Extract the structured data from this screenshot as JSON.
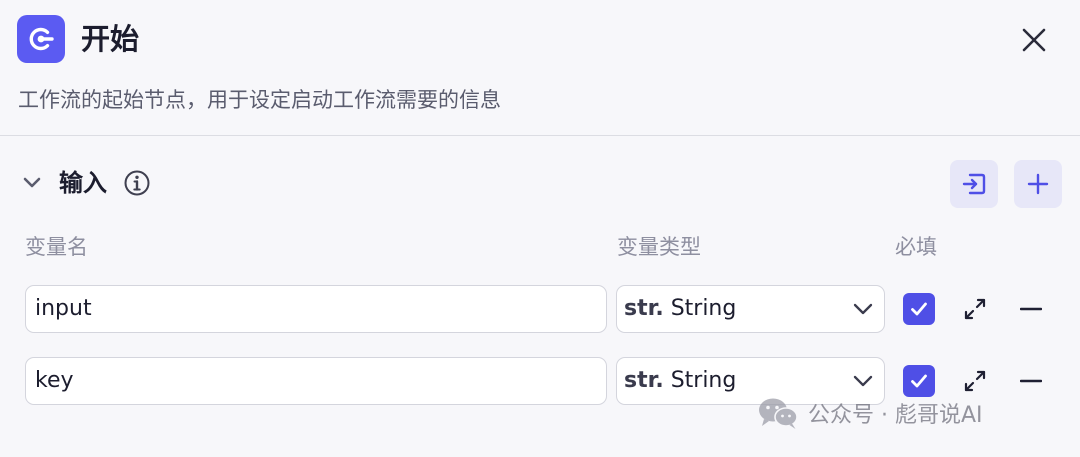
{
  "header": {
    "title": "开始",
    "description": "工作流的起始节点，用于设定启动工作流需要的信息",
    "logo_icon": "start-node-icon",
    "close_icon": "close-icon"
  },
  "inputs_section": {
    "title": "输入",
    "expanded": true,
    "columns": {
      "name": "变量名",
      "type": "变量类型",
      "required": "必填"
    },
    "rows": [
      {
        "name": "input",
        "type_prefix": "str.",
        "type_label": "String",
        "required": true
      },
      {
        "name": "key",
        "type_prefix": "str.",
        "type_label": "String",
        "required": true
      }
    ]
  },
  "watermark": {
    "text": "公众号 · 彪哥说AI"
  },
  "colors": {
    "accent": "#5b5bf2",
    "checkbox": "#4f4fe6",
    "background": "#f7f7fa",
    "button_bg": "#e7e7f8"
  }
}
